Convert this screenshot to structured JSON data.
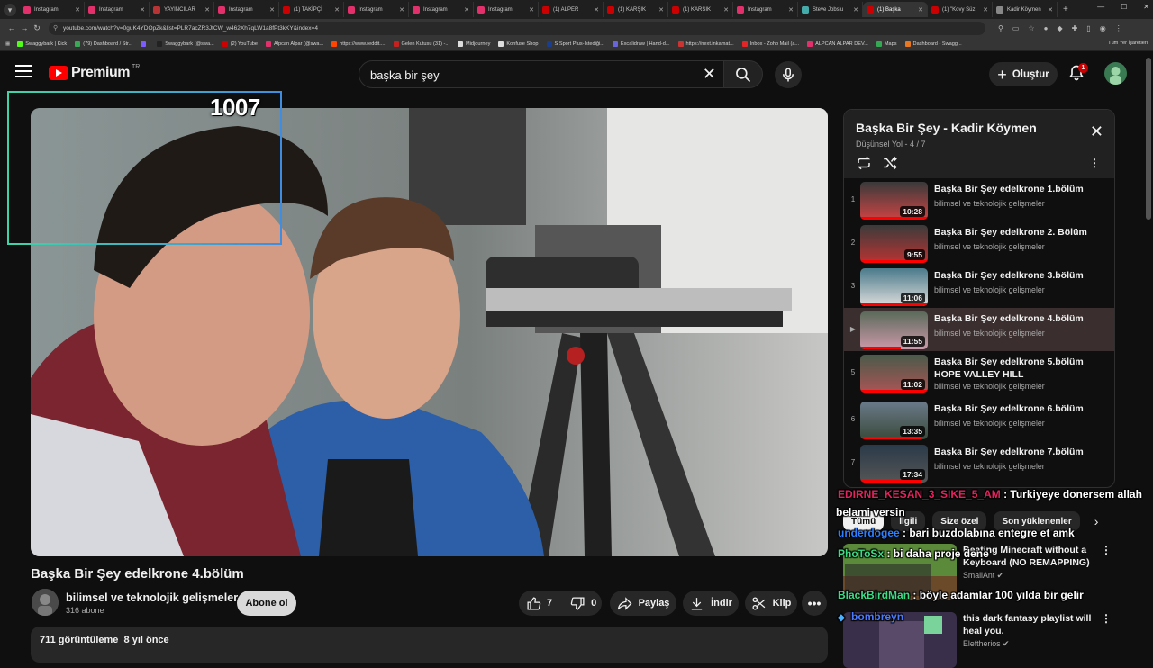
{
  "browser": {
    "tabs": [
      {
        "label": "Instagram",
        "color": "#e1306c"
      },
      {
        "label": "Instagram",
        "color": "#e1306c"
      },
      {
        "label": "YAYINCILAR",
        "color": "#b83333"
      },
      {
        "label": "Instagram",
        "color": "#e1306c"
      },
      {
        "label": "(1) TAKİPÇİ",
        "color": "#cc0000"
      },
      {
        "label": "Instagram",
        "color": "#e1306c"
      },
      {
        "label": "Instagram",
        "color": "#e1306c"
      },
      {
        "label": "Instagram",
        "color": "#e1306c"
      },
      {
        "label": "(1) ALPER",
        "color": "#cc0000"
      },
      {
        "label": "(1) KARŞIK",
        "color": "#cc0000"
      },
      {
        "label": "(1) KARŞIK",
        "color": "#cc0000"
      },
      {
        "label": "Instagram",
        "color": "#e1306c"
      },
      {
        "label": "Steve Jobs'u",
        "color": "#4aa"
      },
      {
        "label": "(1) Başka",
        "color": "#cc0000",
        "active": true
      },
      {
        "label": "(1) \"Kovy Süz",
        "color": "#cc0000"
      },
      {
        "label": "Kadir Köymen",
        "color": "#888"
      }
    ],
    "url": "youtube.com/watch?v=0guK4YDOpZk&list=PLR7acZR3JfCW_w462Xh7qLW1a8fPt3kKY&index=4",
    "bookmarks": [
      {
        "label": "Swaggybark | Kick",
        "color": "#53fc18"
      },
      {
        "label": "(79) Dashboard / Str...",
        "color": "#3aa757"
      },
      {
        "label": "",
        "color": "#7c5cff"
      },
      {
        "label": "Swaggybark (@swa...",
        "color": "#222"
      },
      {
        "label": "(2) YouTube",
        "color": "#cc0000"
      },
      {
        "label": "Alpcan Alpar (@swa...",
        "color": "#e1306c"
      },
      {
        "label": "https://www.reddit....",
        "color": "#ff4500"
      },
      {
        "label": "Gelen Kutusu (31) -...",
        "color": "#c5221f"
      },
      {
        "label": "Midjourney",
        "color": "#ddd"
      },
      {
        "label": "Konfuse Shop",
        "color": "#ddd"
      },
      {
        "label": "S Sport Plus-İstediği...",
        "color": "#1a3d8f"
      },
      {
        "label": "Excalidraw | Hand-d...",
        "color": "#6965db"
      },
      {
        "label": "https://next.inkamat...",
        "color": "#c33"
      },
      {
        "label": "Inbox - Zoho Mail (a...",
        "color": "#e42527"
      },
      {
        "label": "ALPCAN ALPAR DEV...",
        "color": "#e1306c"
      },
      {
        "label": "Maps",
        "color": "#34a853"
      },
      {
        "label": "Dashboard - Swagg...",
        "color": "#e87722"
      }
    ],
    "bookmarks_all": "Tüm Yer İşaretleri"
  },
  "header": {
    "logo_text": "Premium",
    "logo_sup": "TR",
    "search_value": "başka bir şey",
    "create_label": "Oluştur",
    "notification_count": "1"
  },
  "overlay": {
    "viewer_count": "1007"
  },
  "video": {
    "title": "Başka Bir Şey edelkrone 4.bölüm",
    "channel": "bilimsel ve teknolojik gelişmeler",
    "subscribers": "316 abone",
    "subscribe_label": "Abone ol",
    "likes": "7",
    "dislikes": "0",
    "share_label": "Paylaş",
    "download_label": "İndir",
    "clip_label": "Klip",
    "views_line": "711 görüntüleme  8 yıl önce"
  },
  "playlist": {
    "title": "Başka Bir Şey - Kadir Köymen",
    "subtitle": "Düşünsel Yol - 4 / 7",
    "items": [
      {
        "index": "1",
        "title": "Başka Bir Şey edelkrone 1.bölüm",
        "channel": "bilimsel ve teknolojik gelişmeler",
        "duration": "10:28",
        "progress": 1.0
      },
      {
        "index": "2",
        "title": "Başka Bir Şey edelkrone 2. Bölüm",
        "channel": "bilimsel ve teknolojik gelişmeler",
        "duration": "9:55",
        "progress": 1.0
      },
      {
        "index": "3",
        "title": "Başka Bir Şey edelkrone 3.bölüm",
        "channel": "bilimsel ve teknolojik gelişmeler",
        "duration": "11:06",
        "progress": 1.0
      },
      {
        "index": "▶",
        "title": "Başka Bir Şey edelkrone 4.bölüm",
        "channel": "bilimsel ve teknolojik gelişmeler",
        "duration": "11:55",
        "progress": 0.6,
        "current": true
      },
      {
        "index": "5",
        "title": "Başka Bir Şey edelkrone 5.bölüm HOPE VALLEY HILL",
        "channel": "bilimsel ve teknolojik gelişmeler",
        "duration": "11:02",
        "progress": 1.0
      },
      {
        "index": "6",
        "title": "Başka Bir Şey edelkrone 6.bölüm",
        "channel": "bilimsel ve teknolojik gelişmeler",
        "duration": "13:35",
        "progress": 0.9
      },
      {
        "index": "7",
        "title": "Başka Bir Şey edelkrone 7.bölüm",
        "channel": "bilimsel ve teknolojik gelişmeler",
        "duration": "17:34",
        "progress": 0.9
      }
    ]
  },
  "chips": [
    "Tümü",
    "İlgili",
    "Size özel",
    "Son yüklenenler"
  ],
  "recommendations": [
    {
      "title": "Beating Minecraft without a Keyboard (NO REMAPPING)",
      "channel": "SmallAnt ✔"
    },
    {
      "title": "this dark fantasy playlist will heal you.",
      "channel": "Eleftherios ✔"
    }
  ],
  "chat": [
    {
      "user": "EDIRNE_KESAN_3_SIKE_5_AM",
      "msg": " : Turkiyeye donersem allah",
      "color": "#e0245e"
    },
    {
      "user": "",
      "msg": "belami versin",
      "color": "#ffffff"
    },
    {
      "user": "underdogee",
      "msg": " : bari buzdolabına entegre et amk",
      "color": "#2e7fff"
    },
    {
      "user": "PhoToSx",
      "msg": " : bi daha proje dene",
      "color": "#3ddc84"
    },
    {
      "user": "BlackBirdMan",
      "msg": " : böyle adamlar 100 yılda bir gelir",
      "color": "#3ddc84"
    },
    {
      "user": "bombreyn",
      "msg": "",
      "color": "#4a7bff"
    }
  ]
}
